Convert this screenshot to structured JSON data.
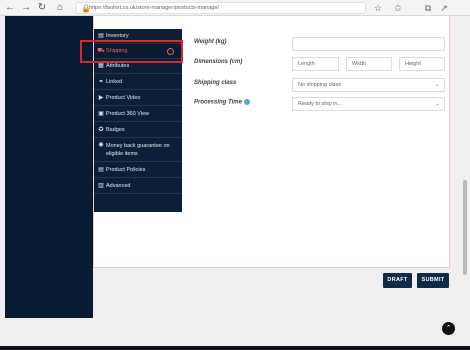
{
  "browser": {
    "url": "https://fanfort.co.uk/store-manager/products-manage/",
    "back_icon": "←",
    "forward_icon": "→",
    "refresh_icon": "↻",
    "home_icon": "⌂",
    "lock_icon": "🔒",
    "favorite_icon": "☆",
    "favorites_icon": "✩",
    "collections_icon": "⧉",
    "share_icon": "↗"
  },
  "tabs": [
    {
      "icon": "▤",
      "label": "Inventory"
    },
    {
      "icon": "⛟",
      "label": "Shipping",
      "badge": "◎"
    },
    {
      "icon": "▦",
      "label": "Attributes"
    },
    {
      "icon": "⚭",
      "label": "Linked"
    },
    {
      "icon": "▶",
      "label": "Product Video"
    },
    {
      "icon": "▣",
      "label": "Product 360 View"
    },
    {
      "icon": "✪",
      "label": "Badges"
    },
    {
      "icon": "◉",
      "label": "Money back guarantee on eligible items"
    },
    {
      "icon": "▤",
      "label": "Product Policies"
    },
    {
      "icon": "▥",
      "label": "Advanced"
    }
  ],
  "form": {
    "weight_label": "Weight (kg)",
    "weight_value": "",
    "dimensions_label": "Dimensions (cm)",
    "length_placeholder": "Length",
    "width_placeholder": "Width",
    "height_placeholder": "Height",
    "shipping_class_label": "Shipping class",
    "shipping_class_value": "No shipping class",
    "processing_time_label": "Processing Time",
    "processing_time_value": "Ready to ship in..."
  },
  "buttons": {
    "draft": "DRAFT",
    "submit": "SUBMIT"
  },
  "scroll_top_icon": "⌃",
  "colors": {
    "sidebar_bg": "#081b33",
    "active_tab": "#e0655a",
    "button_bg": "#0e2b48",
    "highlight": "#d62a2a"
  }
}
